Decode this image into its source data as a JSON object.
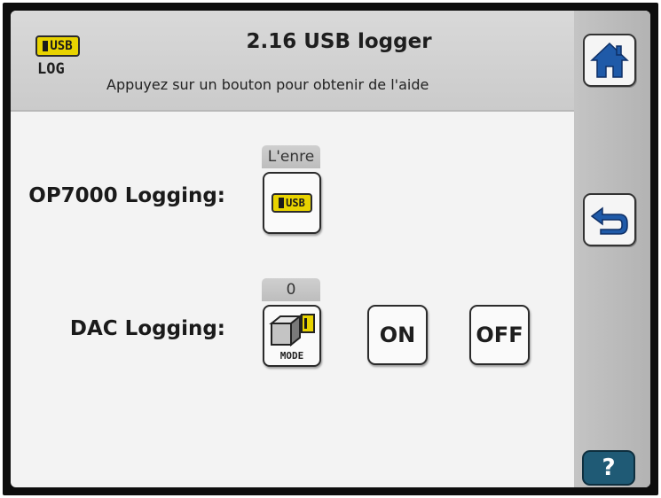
{
  "header": {
    "icon_badge": "USB",
    "icon_label": "LOG",
    "title": "2.16 USB logger",
    "subtitle": "Appuyez sur un bouton pour obtenir de l'aide"
  },
  "side_buttons": {
    "home_icon": "home-icon",
    "back_icon": "back-arrow-icon",
    "help_label": "?"
  },
  "rows": {
    "op7000": {
      "label": "OP7000 Logging:",
      "status": "L'enre",
      "button_badge": "USB"
    },
    "dac": {
      "label": "DAC Logging:",
      "status": "0",
      "mode_label": "MODE",
      "on_label": "ON",
      "off_label": "OFF"
    }
  },
  "colors": {
    "usb_badge": "#e8d300",
    "help_button": "#1f5a75",
    "home_icon": "#1f5aa8",
    "back_icon": "#1f5aa8"
  }
}
